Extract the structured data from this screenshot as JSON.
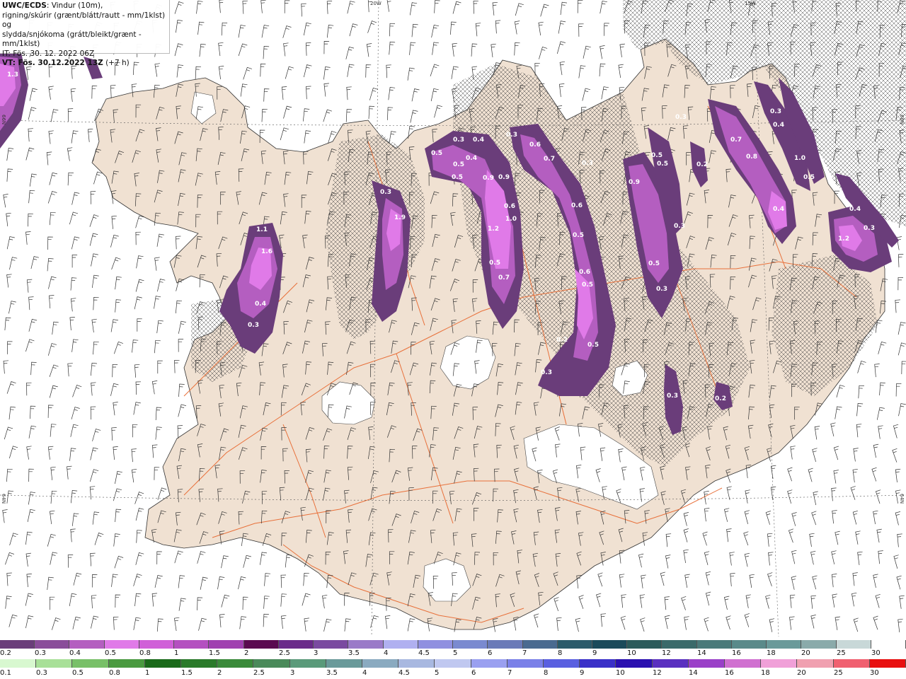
{
  "header": {
    "model": "UWC/ECDS",
    "line1": ": Vindur (10m),",
    "line2": "rigning/skúrir (grænt/blátt/rautt - mm/1klst) og",
    "line3": "slydda/snjókoma (grátt/bleikt/grænt - mm/1klst)",
    "it": "IT: Fös. 30. 12. 2022 06Z",
    "vt_bold": "VT: Fös. 30.12.2022 13Z",
    "vt_step": " (+7 h)"
  },
  "graticule": {
    "lon_top_1": "20W",
    "lon_top_2": "15W",
    "lat_left_1": "66N",
    "lat_left_2": "64N",
    "lat_right_1": "66N",
    "lat_right_2": "64N"
  },
  "colors": {
    "land": "#f0e1d2",
    "sea": "#ffffff",
    "roads": "#e8703a",
    "hatch": "#555555",
    "snow_dark": "#6a3d7a",
    "snow_mid": "#a148c0",
    "snow_light": "#e26ee8"
  },
  "precip_labels": [
    {
      "v": "1.3"
    },
    {
      "v": "1.1"
    },
    {
      "v": "1.6"
    },
    {
      "v": "0.4"
    },
    {
      "v": "0.3"
    },
    {
      "v": "0.3"
    },
    {
      "v": "1.9"
    },
    {
      "v": "0.5"
    },
    {
      "v": "0.3"
    },
    {
      "v": "0.4"
    },
    {
      "v": "0.5"
    },
    {
      "v": "0.5"
    },
    {
      "v": "0.4"
    },
    {
      "v": "0.9"
    },
    {
      "v": "0.9"
    },
    {
      "v": "0.6"
    },
    {
      "v": "1.2"
    },
    {
      "v": "1.0"
    },
    {
      "v": "0.5"
    },
    {
      "v": "0.7"
    },
    {
      "v": "0.3"
    },
    {
      "v": "0.6"
    },
    {
      "v": "0.7"
    },
    {
      "v": "0.3"
    },
    {
      "v": "0.6"
    },
    {
      "v": "0.5"
    },
    {
      "v": "0.6"
    },
    {
      "v": "0.5"
    },
    {
      "v": "0.2"
    },
    {
      "v": "0.5"
    },
    {
      "v": "0.3"
    },
    {
      "v": "0.5"
    },
    {
      "v": "0.5"
    },
    {
      "v": "0.9"
    },
    {
      "v": "0.3"
    },
    {
      "v": "0.5"
    },
    {
      "v": "0.3"
    },
    {
      "v": "0.3"
    },
    {
      "v": "0.2"
    },
    {
      "v": "0.7"
    },
    {
      "v": "0.8"
    },
    {
      "v": "0.3"
    },
    {
      "v": "0.4"
    },
    {
      "v": "1.0"
    },
    {
      "v": "0.4"
    },
    {
      "v": "0.5"
    },
    {
      "v": "1.2"
    },
    {
      "v": "0.4"
    },
    {
      "v": "0.3"
    },
    {
      "v": "0.2"
    },
    {
      "v": "0.3"
    }
  ],
  "scale_snow": {
    "labels": [
      "0.2",
      "0.3",
      "0.4",
      "0.5",
      "0.8",
      "1",
      "1.5",
      "2",
      "2.5",
      "3",
      "3.5",
      "4",
      "4.5",
      "5",
      "6",
      "7",
      "8",
      "9",
      "10",
      "12",
      "14",
      "16",
      "18",
      "20",
      "25",
      "30"
    ],
    "colors": [
      "#6a3d7a",
      "#8a4d9a",
      "#b45ec0",
      "#e07ae8",
      "#d060d8",
      "#b450c0",
      "#a040b0",
      "#5a0a50",
      "#6a2a8a",
      "#7a4aa0",
      "#9a7ac8",
      "#b0b0f0",
      "#9090e0",
      "#7a8ad0",
      "#6a7ab8",
      "#4a6a90",
      "#2a5a6a",
      "#1a4a5a",
      "#2a5a5a",
      "#3a6a6a",
      "#4a7a7a",
      "#5a8a8a",
      "#6a9a9a",
      "#8aaaaa",
      "#c8d8d8",
      "#ffffff"
    ]
  },
  "scale_rain": {
    "labels": [
      "0.1",
      "0.3",
      "0.5",
      "0.8",
      "1",
      "1.5",
      "2",
      "2.5",
      "3",
      "3.5",
      "4",
      "4.5",
      "5",
      "6",
      "7",
      "8",
      "9",
      "10",
      "12",
      "14",
      "16",
      "18",
      "20",
      "25",
      "30"
    ],
    "colors": [
      "#d8f8d0",
      "#a8e098",
      "#78c068",
      "#4a9a40",
      "#1a6a1a",
      "#2a7a2a",
      "#3a8a3a",
      "#4a8a5a",
      "#5a9a7a",
      "#6a9a9a",
      "#8aaac0",
      "#a8b8e0",
      "#c0c8f0",
      "#9aa0f0",
      "#7a80e8",
      "#5a60e0",
      "#3a30c8",
      "#2a10b0",
      "#5a30c0",
      "#9a40c8",
      "#d070d0",
      "#f0a0d8",
      "#f0a0b0",
      "#f06070",
      "#e81010"
    ]
  }
}
